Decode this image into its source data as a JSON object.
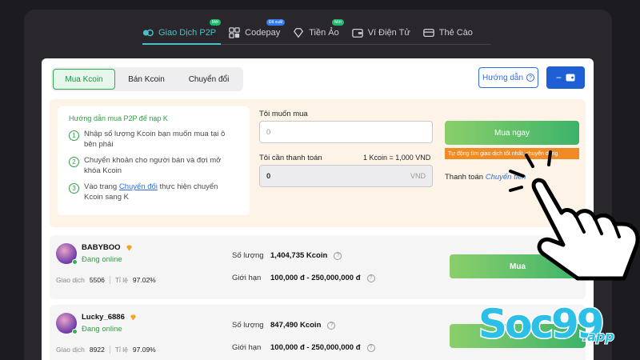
{
  "nav": {
    "tabs": [
      {
        "label": "Giao Dịch P2P",
        "badge": "Mới",
        "badge_color": "#1fb86f",
        "icon": "p2p-icon",
        "active": true
      },
      {
        "label": "Codepay",
        "badge": "Đã xuất",
        "badge_color": "#2f7cf6",
        "icon": "codepay-icon",
        "active": false
      },
      {
        "label": "Tiền Ảo",
        "badge": "Mới",
        "badge_color": "#1fb86f",
        "icon": "diamond-icon",
        "active": false
      },
      {
        "label": "Ví Điện Tử",
        "badge": "",
        "icon": "wallet-icon",
        "active": false
      },
      {
        "label": "Thẻ Cào",
        "badge": "",
        "icon": "card-icon",
        "active": false
      }
    ]
  },
  "segment": {
    "buy": "Mua Kcoin",
    "sell": "Bán Kcoin",
    "transfer": "Chuyển đổi"
  },
  "guide_button": "Hướng dẫn",
  "guide": {
    "title": "Hướng dẫn mua P2P để nạp K",
    "steps": [
      {
        "num": "1",
        "text": "Nhập số lượng Kcoin bạn muốn mua tại ô bên phải"
      },
      {
        "num": "2",
        "text": "Chuyển khoản cho người bán và đợi mở khóa Kcoin"
      },
      {
        "num": "3",
        "pre": "Vào trang ",
        "link": "Chuyển đổi",
        "post": " thực hiện chuyển Kcoin sang K"
      }
    ]
  },
  "form": {
    "want_label": "Tôi muốn mua",
    "want_placeholder": "0",
    "pay_label": "Tôi cần thanh toán",
    "rate": "1 Kcoin = 1,000 VND",
    "pay_value": "0",
    "pay_unit": "VND"
  },
  "buy_now": {
    "label": "Mua ngay",
    "tip": "Tự động tìm giao dịch tốt nhất, chuyển dùng"
  },
  "payment": {
    "label": "Thanh toán",
    "method": "Chuyển tiền"
  },
  "sellers": [
    {
      "name": "BABYBOO",
      "status": "Đang online",
      "trades_label": "Giao dịch",
      "trades": "5506",
      "rate_label": "Tỉ lệ",
      "rate": "97.02%",
      "qty_label": "Số lượng",
      "qty": "1,404,735 Kcoin",
      "limit_label": "Giới hạn",
      "limit": "100,000 đ - 250,000,000 đ",
      "button": "Mua"
    },
    {
      "name": "Lucky_6886",
      "status": "Đang online",
      "trades_label": "Giao dịch",
      "trades": "8922",
      "rate_label": "Tỉ lệ",
      "rate": "97.09%",
      "qty_label": "Số lượng",
      "qty": "847,490 Kcoin",
      "limit_label": "Giới hạn",
      "limit": "100,000 đ - 250,000,000 đ",
      "button": "Mua"
    }
  ],
  "watermark": {
    "brand": "Soc99",
    "suffix": ".app"
  },
  "colors": {
    "accent_teal": "#45c3c9",
    "green": "#2ea043",
    "blue": "#2d6fe0",
    "orange": "#f08a24"
  }
}
